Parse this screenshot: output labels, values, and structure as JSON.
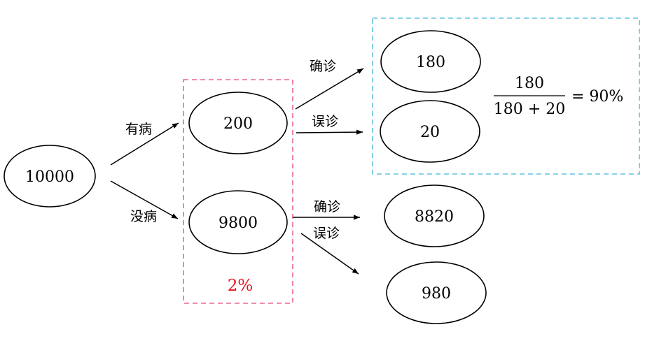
{
  "nodes": {
    "root": "10000",
    "sick": "200",
    "healthy": "9800",
    "sick_confirmed": "180",
    "sick_misdiagnosed": "20",
    "healthy_confirmed": "8820",
    "healthy_misdiagnosed": "980"
  },
  "edges": {
    "to_sick": "有病",
    "to_healthy": "没病",
    "sick_confirm": "确诊",
    "sick_misdiagnose": "误诊",
    "healthy_confirm": "确诊",
    "healthy_misdiagnose": "误诊"
  },
  "groups": {
    "middle_note": "2%",
    "middle_note_color": "#e8131e",
    "middle_box_color": "#e8679a",
    "right_box_color": "#62c3e0"
  },
  "formula": {
    "numerator": "180",
    "denominator": "180 + 20",
    "result": "= 90%"
  }
}
